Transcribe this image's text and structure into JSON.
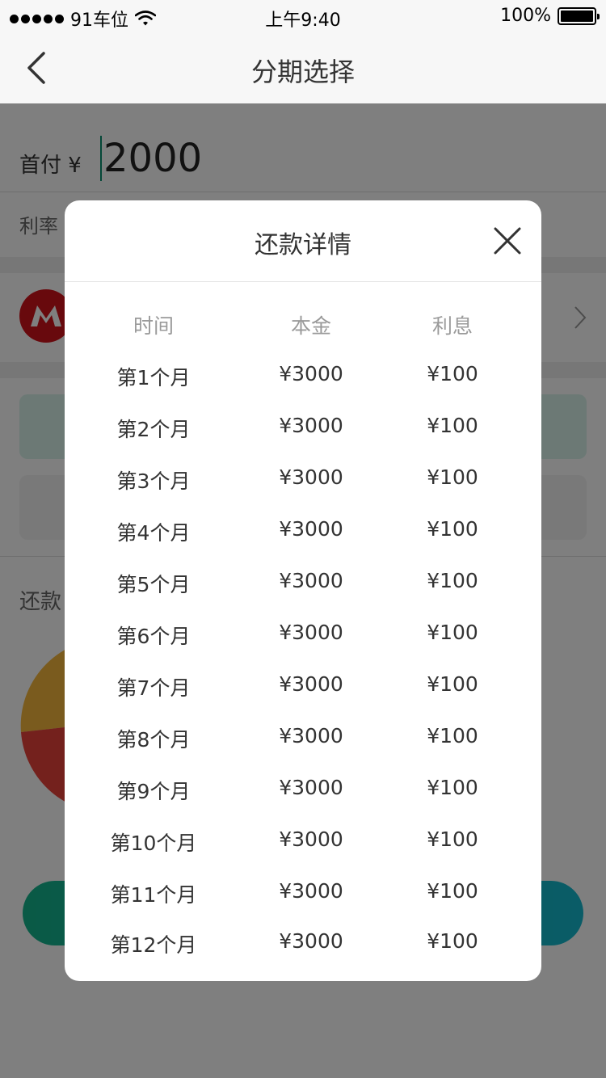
{
  "status": {
    "carrier": "91车位",
    "time": "上午9:40",
    "battery": "100%"
  },
  "nav": {
    "title": "分期选择"
  },
  "page": {
    "down_payment_label": "首付 ¥",
    "down_payment_value": "2000",
    "rate_label": "利率",
    "plan_label": "还款"
  },
  "modal": {
    "title": "还款详情",
    "headers": [
      "时间",
      "本金",
      "利息"
    ],
    "rows": [
      {
        "period": "第1个月",
        "principal": "¥3000",
        "interest": "¥100"
      },
      {
        "period": "第2个月",
        "principal": "¥3000",
        "interest": "¥100"
      },
      {
        "period": "第3个月",
        "principal": "¥3000",
        "interest": "¥100"
      },
      {
        "period": "第4个月",
        "principal": "¥3000",
        "interest": "¥100"
      },
      {
        "period": "第5个月",
        "principal": "¥3000",
        "interest": "¥100"
      },
      {
        "period": "第6个月",
        "principal": "¥3000",
        "interest": "¥100"
      },
      {
        "period": "第7个月",
        "principal": "¥3000",
        "interest": "¥100"
      },
      {
        "period": "第8个月",
        "principal": "¥3000",
        "interest": "¥100"
      },
      {
        "period": "第9个月",
        "principal": "¥3000",
        "interest": "¥100"
      },
      {
        "period": "第10个月",
        "principal": "¥3000",
        "interest": "¥100"
      },
      {
        "period": "第11个月",
        "principal": "¥3000",
        "interest": "¥100"
      },
      {
        "period": "第12个月",
        "principal": "¥3000",
        "interest": "¥100"
      }
    ]
  },
  "colors": {
    "accent": "#14b58c",
    "bank_red": "#d0121b"
  },
  "icons": {
    "back": "chevron-left-icon",
    "close": "close-icon",
    "wifi": "wifi-icon",
    "battery": "battery-icon"
  }
}
